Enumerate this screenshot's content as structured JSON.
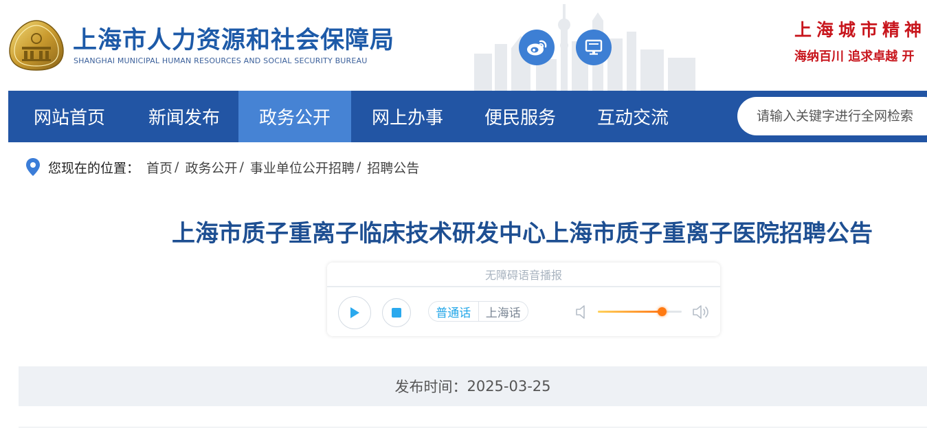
{
  "header": {
    "site_title": "上海市人力资源和社会保障局",
    "site_subtitle": "SHANGHAI MUNICIPAL HUMAN RESOURCES AND SOCIAL SECURITY BUREAU",
    "social_icons": [
      "weibo-icon",
      "desktop-icon"
    ],
    "slogan_line1": "上海城市精神",
    "slogan_line2": "海纳百川  追求卓越  开"
  },
  "nav": {
    "items": [
      {
        "label": "网站首页",
        "active": false
      },
      {
        "label": "新闻发布",
        "active": false
      },
      {
        "label": "政务公开",
        "active": true
      },
      {
        "label": "网上办事",
        "active": false
      },
      {
        "label": "便民服务",
        "active": false
      },
      {
        "label": "互动交流",
        "active": false
      }
    ],
    "search_placeholder": "请输入关键字进行全网检索"
  },
  "breadcrumb": {
    "label": "您现在的位置：",
    "items": [
      "首页",
      "政务公开",
      "事业单位公开招聘",
      "招聘公告"
    ],
    "separator": "/"
  },
  "article": {
    "title": "上海市质子重离子临床技术研发中心上海市质子重离子医院招聘公告",
    "publish_label": "发布时间：",
    "publish_date": "2025-03-25"
  },
  "player": {
    "header": "无障碍语音播报",
    "lang_mandarin": "普通话",
    "lang_shanghainese": "上海话",
    "active_lang": "普通话",
    "volume": 0.76
  },
  "colors": {
    "brand_blue": "#2255a4",
    "nav_active": "#4683d4",
    "title_blue": "#1e4f92",
    "slogan_red": "#c8161d",
    "accent_cyan": "#22a6e8",
    "volume_orange": "#ff7a12"
  }
}
